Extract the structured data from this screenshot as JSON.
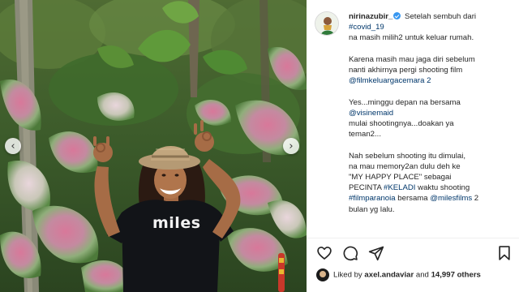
{
  "post": {
    "username": "nirinazubir_",
    "caption": {
      "line1_text": "Setelah sembuh dari",
      "hashtag_covid": "#covid_19",
      "line3": "na masih milih2 untuk keluar rumah.",
      "line4": "Karena masih mau jaga diri sebelum",
      "line5": "nanti akhirnya pergi shooting film",
      "mention_film": "@filmkeluargacemara 2",
      "line7": "Yes...minggu depan na bersama",
      "mention_visine": "@visinemaid",
      "line9": "mulai shootingnya...doakan ya",
      "line10": "teman2...",
      "line11": "Nah sebelum shooting itu dimulai,",
      "line12": "na mau memory2an dulu deh ke",
      "line13": "\"MY HAPPY PLACE\" sebagai",
      "line14_prefix": "PECINTA ",
      "hashtag_keladi": "#KELADI",
      "line14_suffix": " waktu shooting",
      "hashtag_filmparanoia": "#filmparanoia",
      "line15_mid": " bersama ",
      "mention_miles": "@milesfilms",
      "line15_suffix": " 2",
      "line16": "bulan yg lalu."
    },
    "likes": {
      "prefix": "Liked by ",
      "user": "axel.andaviar",
      "mid": " and ",
      "count": "14,997 others"
    },
    "photo": {
      "shirt_text": "miles"
    },
    "icons": {
      "verified": "verified-badge-icon",
      "like": "heart-icon",
      "comment": "comment-icon",
      "share": "paper-plane-icon",
      "save": "bookmark-icon",
      "prev": "chevron-left-icon",
      "next": "chevron-right-icon"
    },
    "colors": {
      "link": "#00376b",
      "verified": "#3897f0",
      "text": "#262626"
    }
  }
}
